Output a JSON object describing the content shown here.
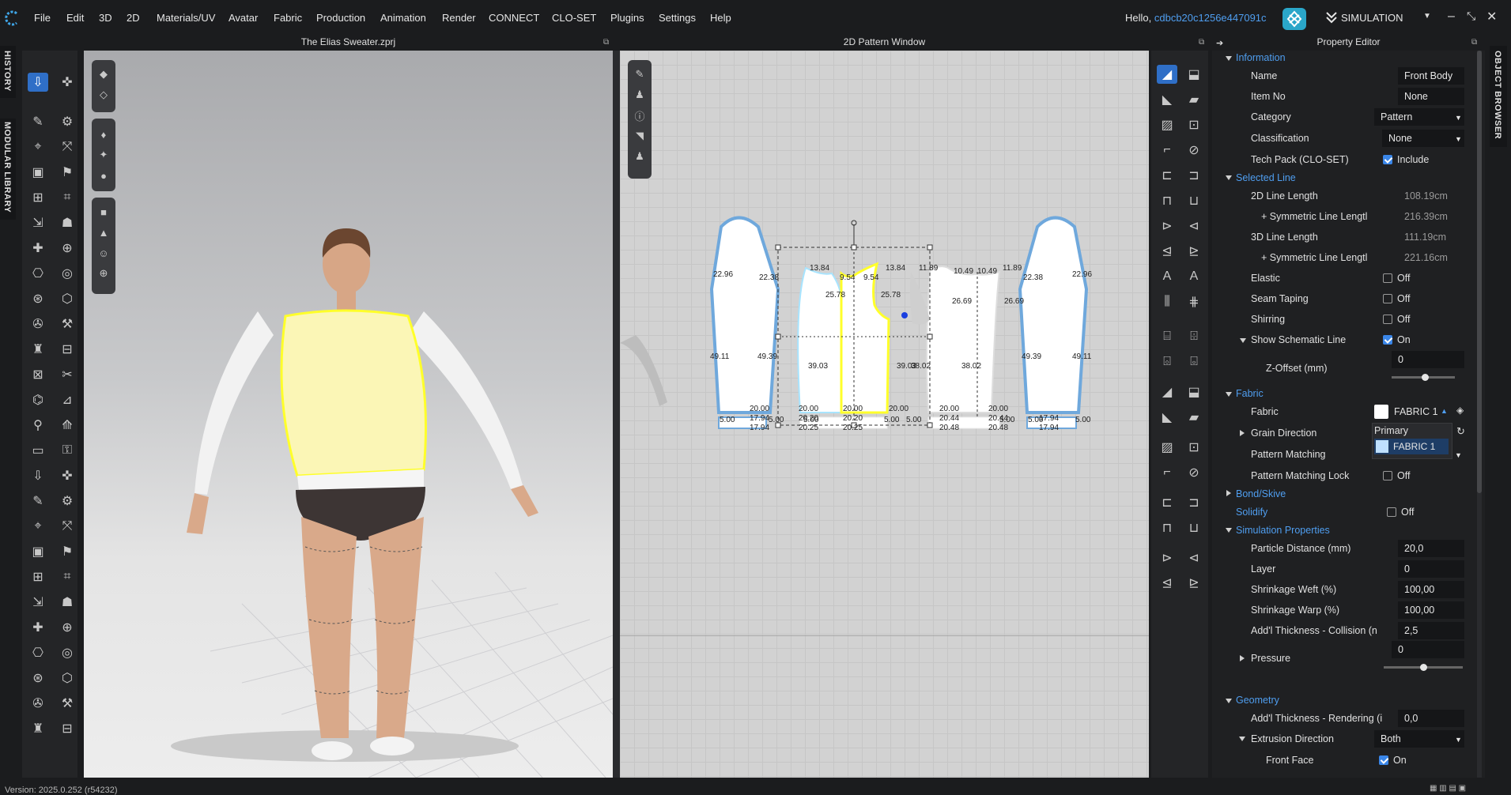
{
  "menu": [
    "File",
    "Edit",
    "3D",
    "2D",
    "Materials/UV",
    "Avatar",
    "Fabric",
    "Production",
    "Animation",
    "Render",
    "CONNECT",
    "CLO-SET",
    "Plugins",
    "Settings",
    "Help"
  ],
  "user": {
    "greeting": "Hello, ",
    "name": "cdbcb20c1256e447091c"
  },
  "mode": "SIMULATION",
  "side_tabs": {
    "history": "HISTORY",
    "modular": "MODULAR LIBRARY",
    "object_browser": "OBJECT BROWSER"
  },
  "panels": {
    "view3d_title": "The Elias Sweater.zprj",
    "view2d_title": "2D Pattern Window",
    "property_title": "Property Editor"
  },
  "measurements": [
    "22.96",
    "22.38",
    "13.84",
    "9.54",
    "9.54",
    "13.84",
    "11.89",
    "10.49",
    "10.49",
    "11.89",
    "22.38",
    "22.96",
    "25.78",
    "25.78",
    "26.69",
    "26.69",
    "49.11",
    "49.39",
    "39.03",
    "39.03",
    "38.02",
    "38.02",
    "49.39",
    "49.11",
    "20.00",
    "20.00",
    "20.00",
    "20.00",
    "20.00",
    "20.00",
    "17.94",
    "20.20",
    "20.20",
    "20.44",
    "20.44",
    "17.94",
    "5.00",
    "5.00",
    "5.00",
    "5.00",
    "5.00",
    "5.00",
    "5.00",
    "5.00",
    "17.94",
    "20.25",
    "20.25",
    "20.48",
    "20.48",
    "17.94"
  ],
  "property": {
    "information": {
      "label": "Information",
      "name_label": "Name",
      "name_value": "Front Body",
      "itemno_label": "Item No",
      "itemno_value": "None",
      "category_label": "Category",
      "category_value": "Pattern",
      "classification_label": "Classification",
      "classification_value": "None",
      "techpack_label": "Tech Pack (CLO-SET)",
      "techpack_value": "Include"
    },
    "selected_line": {
      "label": "Selected Line",
      "len2d_label": "2D Line Length",
      "len2d_value": "108.19cm",
      "sym2d_label": "+ Symmetric Line Lengtl",
      "sym2d_value": "216.39cm",
      "len3d_label": "3D Line Length",
      "len3d_value": "111.19cm",
      "sym3d_label": "+ Symmetric Line Lengtl",
      "sym3d_value": "221.16cm",
      "elastic_label": "Elastic",
      "elastic_value": "Off",
      "taping_label": "Seam Taping",
      "taping_value": "Off",
      "shirring_label": "Shirring",
      "shirring_value": "Off",
      "schematic_label": "Show Schematic Line",
      "schematic_value": "On",
      "zoffset_label": "Z-Offset (mm)",
      "zoffset_value": "0"
    },
    "fabric": {
      "label": "Fabric",
      "fabric_label": "Fabric",
      "fabric_value": "FABRIC 1",
      "dropdown_header": "Primary",
      "dropdown_option": "FABRIC 1",
      "grain_label": "Grain Direction",
      "matching_label": "Pattern Matching",
      "matching_value": "None",
      "matchlock_label": "Pattern Matching Lock",
      "matchlock_value": "Off"
    },
    "bond_label": "Bond/Skive",
    "solidify_label": "Solidify",
    "solidify_value": "Off",
    "simulation": {
      "label": "Simulation Properties",
      "particle_label": "Particle Distance (mm)",
      "particle_value": "20,0",
      "layer_label": "Layer",
      "layer_value": "0",
      "weft_label": "Shrinkage Weft (%)",
      "weft_value": "100,00",
      "warp_label": "Shrinkage Warp (%)",
      "warp_value": "100,00",
      "collision_label": "Add'l Thickness - Collision (n",
      "collision_value": "2,5",
      "pressure_label": "Pressure",
      "pressure_value": "0"
    },
    "geometry": {
      "label": "Geometry",
      "rendering_label": "Add'l Thickness - Rendering (i",
      "rendering_value": "0,0",
      "extrusion_label": "Extrusion Direction",
      "extrusion_value": "Both",
      "frontface_label": "Front Face",
      "frontface_value": "On"
    }
  },
  "status": "Version: 2025.0.252 (r54232)",
  "colors": {
    "accent": "#4f9ef0",
    "selected": "#ffff2a",
    "pattern_outline": "#6fa8dc"
  }
}
